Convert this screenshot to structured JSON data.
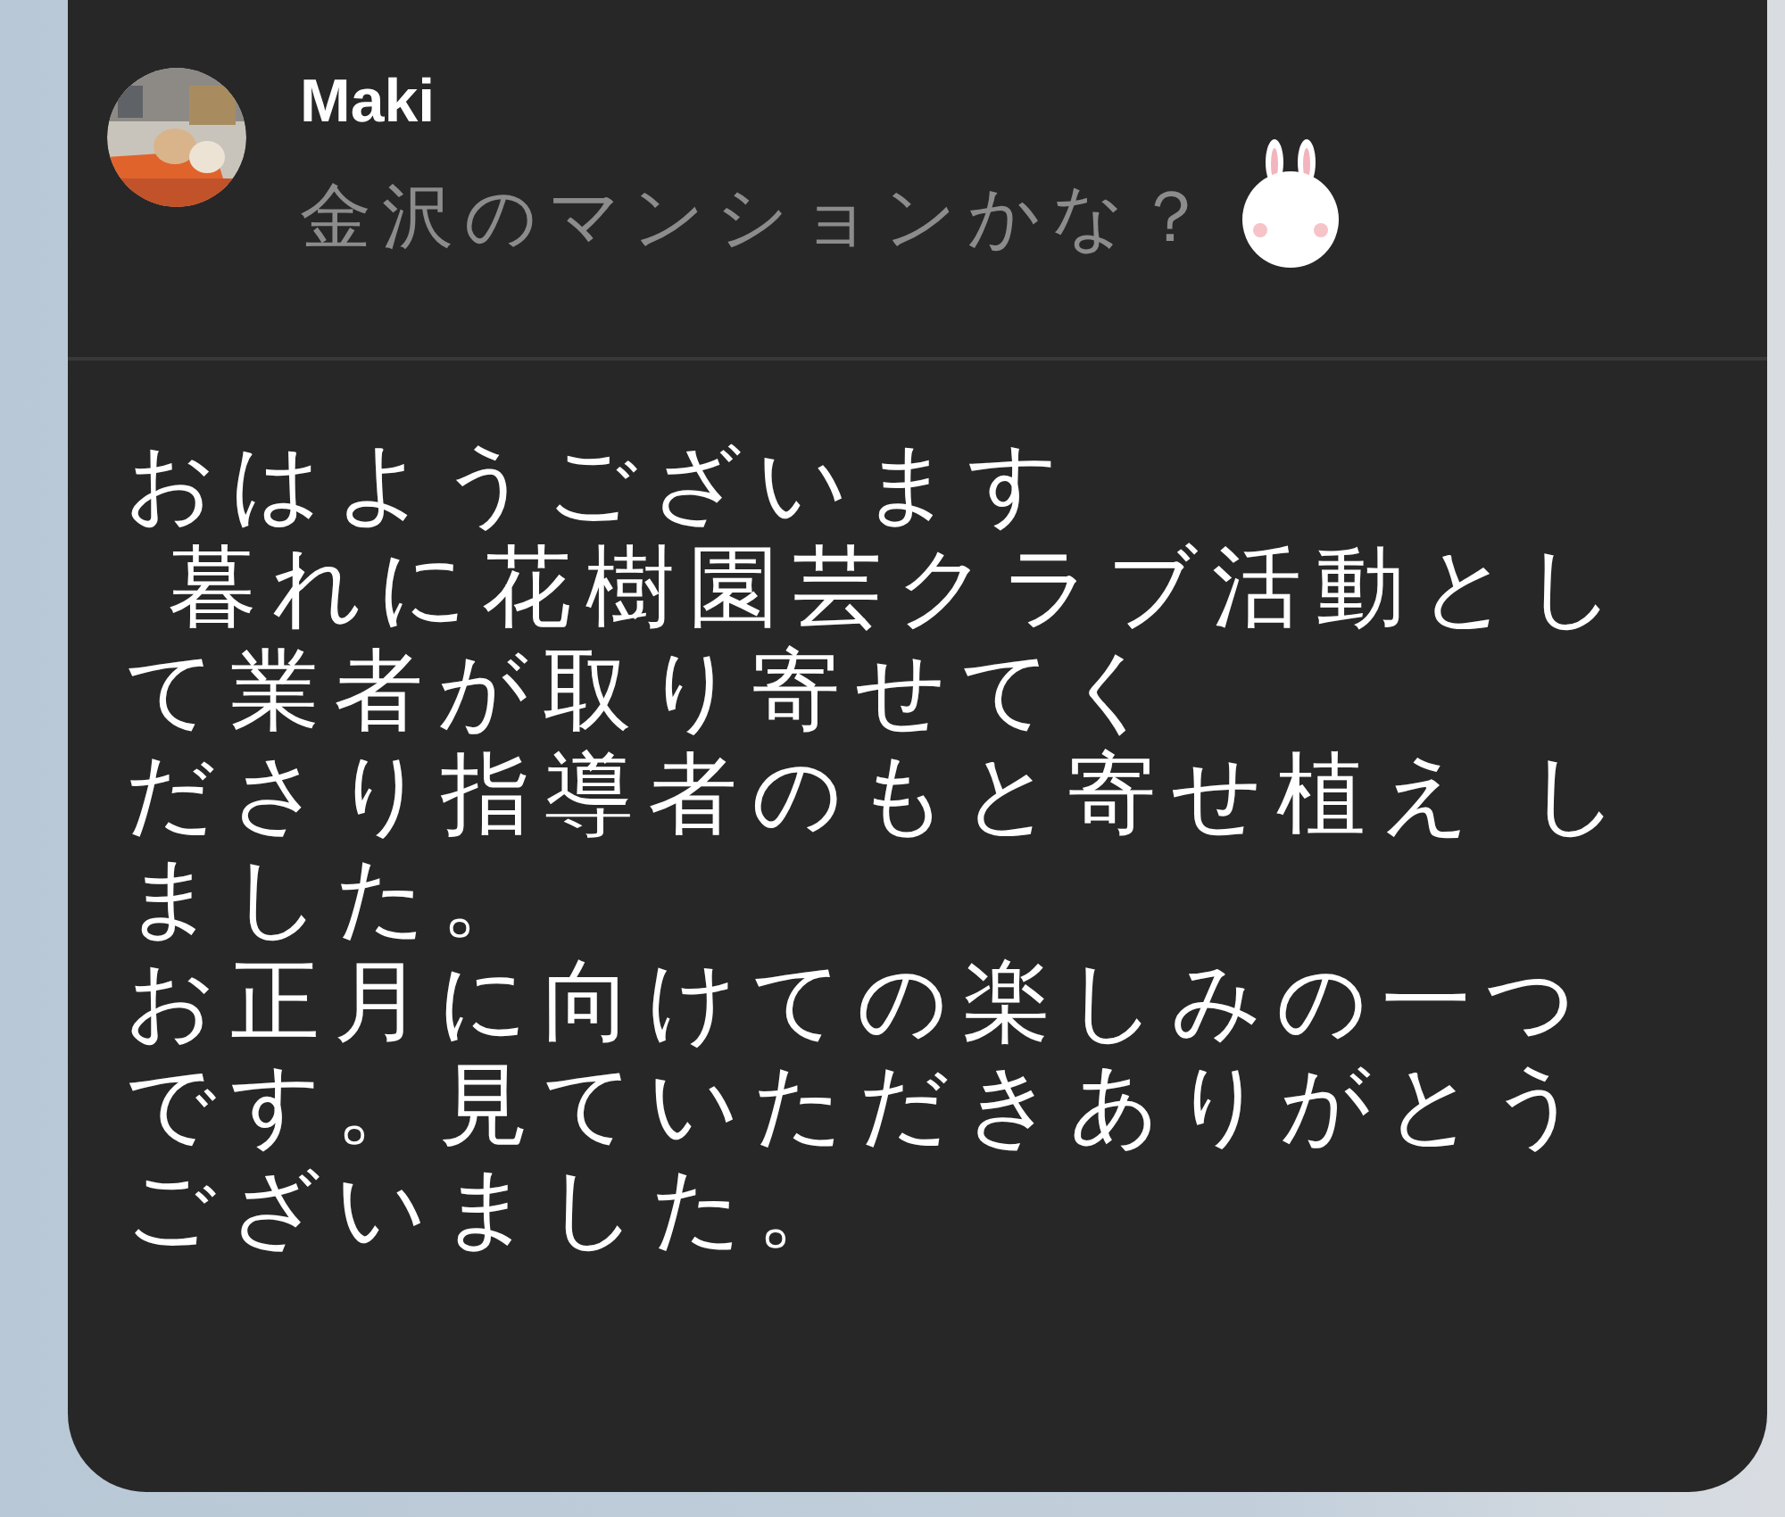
{
  "reply_quote": {
    "sender": "Maki",
    "quoted_text": "金沢のマンションかな？"
  },
  "message": {
    "lines": [
      "おはようございます",
      " 暮れに花樹園芸クラブ活動とし",
      "て業者が取り寄せてく",
      "ださり指導者のもと寄せ植え し",
      "ました。",
      "お正月に向けての楽しみの一つ",
      "です。見ていただきありがとう",
      "ございました。"
    ]
  }
}
